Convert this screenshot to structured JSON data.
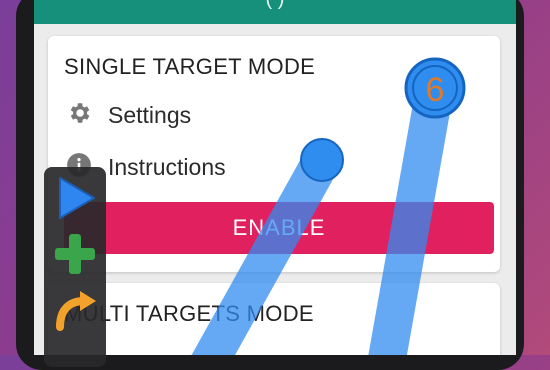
{
  "app": {
    "title": "(   )"
  },
  "single_mode": {
    "title": "SINGLE TARGET MODE",
    "settings_label": "Settings",
    "instructions_label": "Instructions",
    "enable_label": "ENABLE"
  },
  "multi_mode": {
    "title": "MULTI TARGETS MODE"
  },
  "targets": [
    {
      "label": ""
    },
    {
      "label": "6"
    }
  ],
  "colors": {
    "appbar": "#16907a",
    "enable": "#e0205f",
    "target": "#2f8df0",
    "target_label": "#e07a2a",
    "play": "#2f86f0",
    "plus": "#3aa54a",
    "swipe": "#f2a22a"
  },
  "toolbar": {
    "icons": [
      "play-icon",
      "plus-icon",
      "swipe-arrow-icon"
    ]
  }
}
